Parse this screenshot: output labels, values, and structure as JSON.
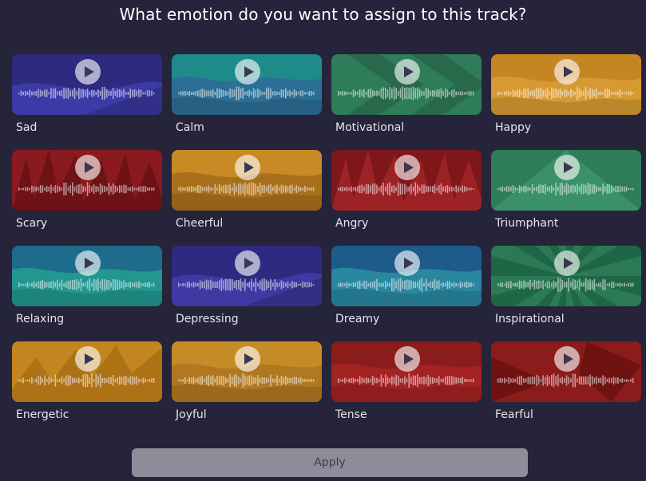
{
  "dialog": {
    "title": "What emotion do you want to assign to this track?",
    "apply_label": "Apply"
  },
  "emotions": [
    {
      "label": "Sad",
      "bg": "#2e2a80",
      "fg": "#3c3aa6",
      "pattern": "hills"
    },
    {
      "label": "Calm",
      "bg": "#1f8a8a",
      "fg": "#2c6f96",
      "pattern": "waves"
    },
    {
      "label": "Motivational",
      "bg": "#2e7d58",
      "fg": "#27694a",
      "pattern": "arrows"
    },
    {
      "label": "Happy",
      "bg": "#c58520",
      "fg": "#d79a32",
      "pattern": "waves"
    },
    {
      "label": "Scary",
      "bg": "#8a1a1e",
      "fg": "#6e1216",
      "pattern": "spikes"
    },
    {
      "label": "Cheerful",
      "bg": "#c88a25",
      "fg": "#a9701c",
      "pattern": "waves"
    },
    {
      "label": "Angry",
      "bg": "#7e161a",
      "fg": "#9c2226",
      "pattern": "spikes"
    },
    {
      "label": "Triumphant",
      "bg": "#2f7d58",
      "fg": "#3a9068",
      "pattern": "triangle"
    },
    {
      "label": "Relaxing",
      "bg": "#1f6b8c",
      "fg": "#22968f",
      "pattern": "waves"
    },
    {
      "label": "Depressing",
      "bg": "#2e2a80",
      "fg": "#3f3aa3",
      "pattern": "hills"
    },
    {
      "label": "Dreamy",
      "bg": "#1d5c8a",
      "fg": "#2a87a0",
      "pattern": "waves"
    },
    {
      "label": "Inspirational",
      "bg": "#2b7a55",
      "fg": "#1f6646",
      "pattern": "rays"
    },
    {
      "label": "Energetic",
      "bg": "#c2851f",
      "fg": "#a76c14",
      "pattern": "zigzag"
    },
    {
      "label": "Joyful",
      "bg": "#c48b27",
      "fg": "#b07820",
      "pattern": "waves"
    },
    {
      "label": "Tense",
      "bg": "#8a1c1c",
      "fg": "#a32222",
      "pattern": "waves"
    },
    {
      "label": "Fearful",
      "bg": "#8c1b1b",
      "fg": "#6f1212",
      "pattern": "shards"
    }
  ],
  "icons": {
    "play": "play-icon",
    "waveform": "waveform-icon"
  }
}
